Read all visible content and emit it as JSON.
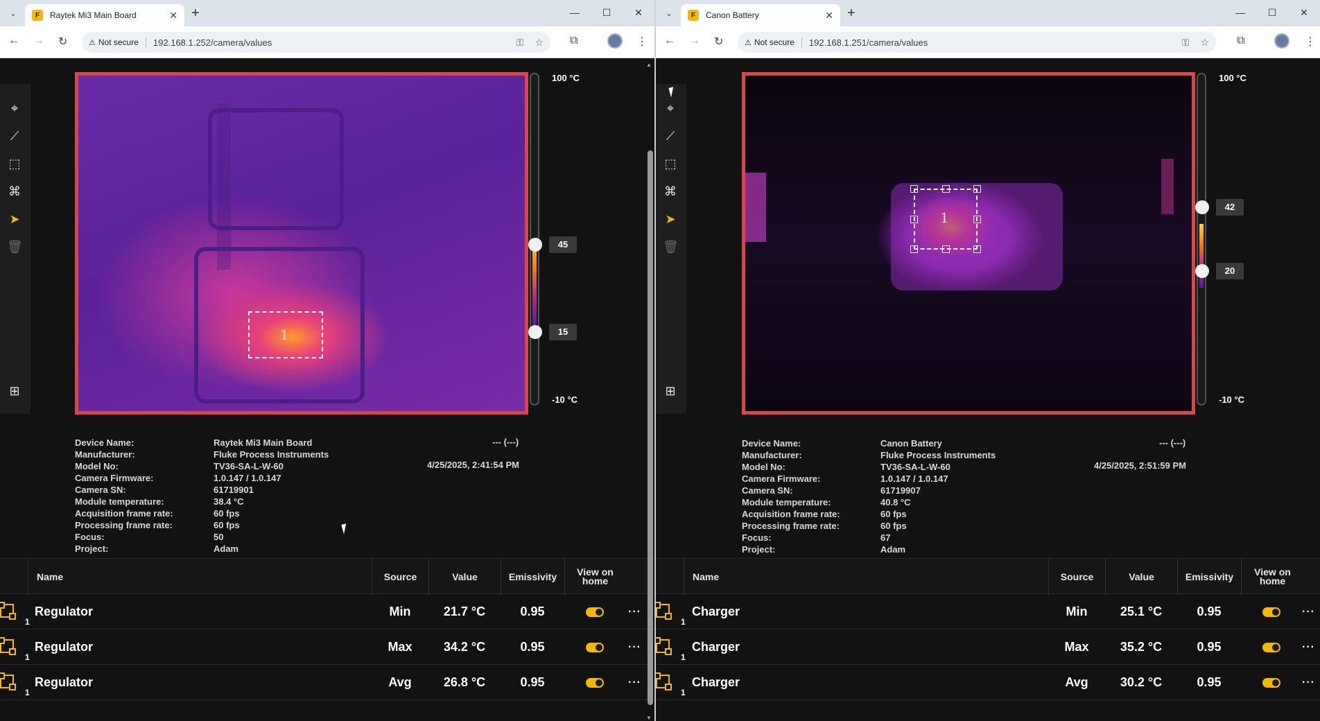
{
  "left": {
    "tab_title": "Raytek Mi3 Main Board",
    "not_secure": "Not secure",
    "url": "192.168.1.252/camera/values",
    "scale": {
      "max": "100 °C",
      "min": "-10 °C",
      "upper": "45",
      "lower": "15",
      "upper_value": 45,
      "lower_value": 15
    },
    "roi_label": "1",
    "status": "--- (---)",
    "timestamp": "4/25/2025, 2:41:54 PM",
    "info": [
      {
        "k": "Device Name:",
        "v": "Raytek Mi3 Main Board"
      },
      {
        "k": "Manufacturer:",
        "v": "Fluke Process Instruments"
      },
      {
        "k": "Model No:",
        "v": "TV36-SA-L-W-60"
      },
      {
        "k": "Camera Firmware:",
        "v": "1.0.147 / 1.0.147"
      },
      {
        "k": "Camera SN:",
        "v": "61719901"
      },
      {
        "k": "Module temperature:",
        "v": "38.4 °C"
      },
      {
        "k": "Acquisition frame rate:",
        "v": "60 fps"
      },
      {
        "k": "Processing frame rate:",
        "v": "60 fps"
      },
      {
        "k": "Focus:",
        "v": "50"
      },
      {
        "k": "Project:",
        "v": "Adam"
      }
    ],
    "headers": {
      "name": "Name",
      "source": "Source",
      "value": "Value",
      "emissivity": "Emissivity",
      "view": "View on home"
    },
    "rows": [
      {
        "num": "1",
        "name": "Regulator",
        "source": "Min",
        "value": "21.7 °C",
        "emissivity": "0.95",
        "more": "···"
      },
      {
        "num": "1",
        "name": "Regulator",
        "source": "Max",
        "value": "34.2 °C",
        "emissivity": "0.95",
        "more": "···"
      },
      {
        "num": "1",
        "name": "Regulator",
        "source": "Avg",
        "value": "26.8 °C",
        "emissivity": "0.95",
        "more": "···"
      }
    ]
  },
  "right": {
    "tab_title": "Canon Battery",
    "not_secure": "Not secure",
    "url": "192.168.1.251/camera/values",
    "scale": {
      "max": "100 °C",
      "min": "-10 °C",
      "upper": "42",
      "lower": "20",
      "upper_value": 42,
      "lower_value": 20
    },
    "roi_label": "1",
    "status": "--- (---)",
    "timestamp": "4/25/2025, 2:51:59 PM",
    "info": [
      {
        "k": "Device Name:",
        "v": "Canon Battery"
      },
      {
        "k": "Manufacturer:",
        "v": "Fluke Process Instruments"
      },
      {
        "k": "Model No:",
        "v": "TV36-SA-L-W-60"
      },
      {
        "k": "Camera Firmware:",
        "v": "1.0.147 / 1.0.147"
      },
      {
        "k": "Camera SN:",
        "v": "61719907"
      },
      {
        "k": "Module temperature:",
        "v": "40.8 °C"
      },
      {
        "k": "Acquisition frame rate:",
        "v": "60 fps"
      },
      {
        "k": "Processing frame rate:",
        "v": "60 fps"
      },
      {
        "k": "Focus:",
        "v": "67"
      },
      {
        "k": "Project:",
        "v": "Adam"
      }
    ],
    "headers": {
      "name": "Name",
      "source": "Source",
      "value": "Value",
      "emissivity": "Emissivity",
      "view": "View on home"
    },
    "rows": [
      {
        "num": "1",
        "name": "Charger",
        "source": "Min",
        "value": "25.1 °C",
        "emissivity": "0.95",
        "more": "···"
      },
      {
        "num": "1",
        "name": "Charger",
        "source": "Max",
        "value": "35.2 °C",
        "emissivity": "0.95",
        "more": "···"
      },
      {
        "num": "1",
        "name": "Charger",
        "source": "Avg",
        "value": "30.2 °C",
        "emissivity": "0.95",
        "more": "···"
      }
    ]
  },
  "icons": {
    "tab_search": "chevron-down-icon",
    "favicon": "fluke-icon",
    "tools": [
      "spot-icon",
      "line-icon",
      "area-icon",
      "polygon-icon",
      "pointer-icon",
      "trash-icon",
      "calculator-icon"
    ]
  },
  "colors": {
    "accent": "#f5b800",
    "frame": "#d84848",
    "page": "#121212"
  }
}
